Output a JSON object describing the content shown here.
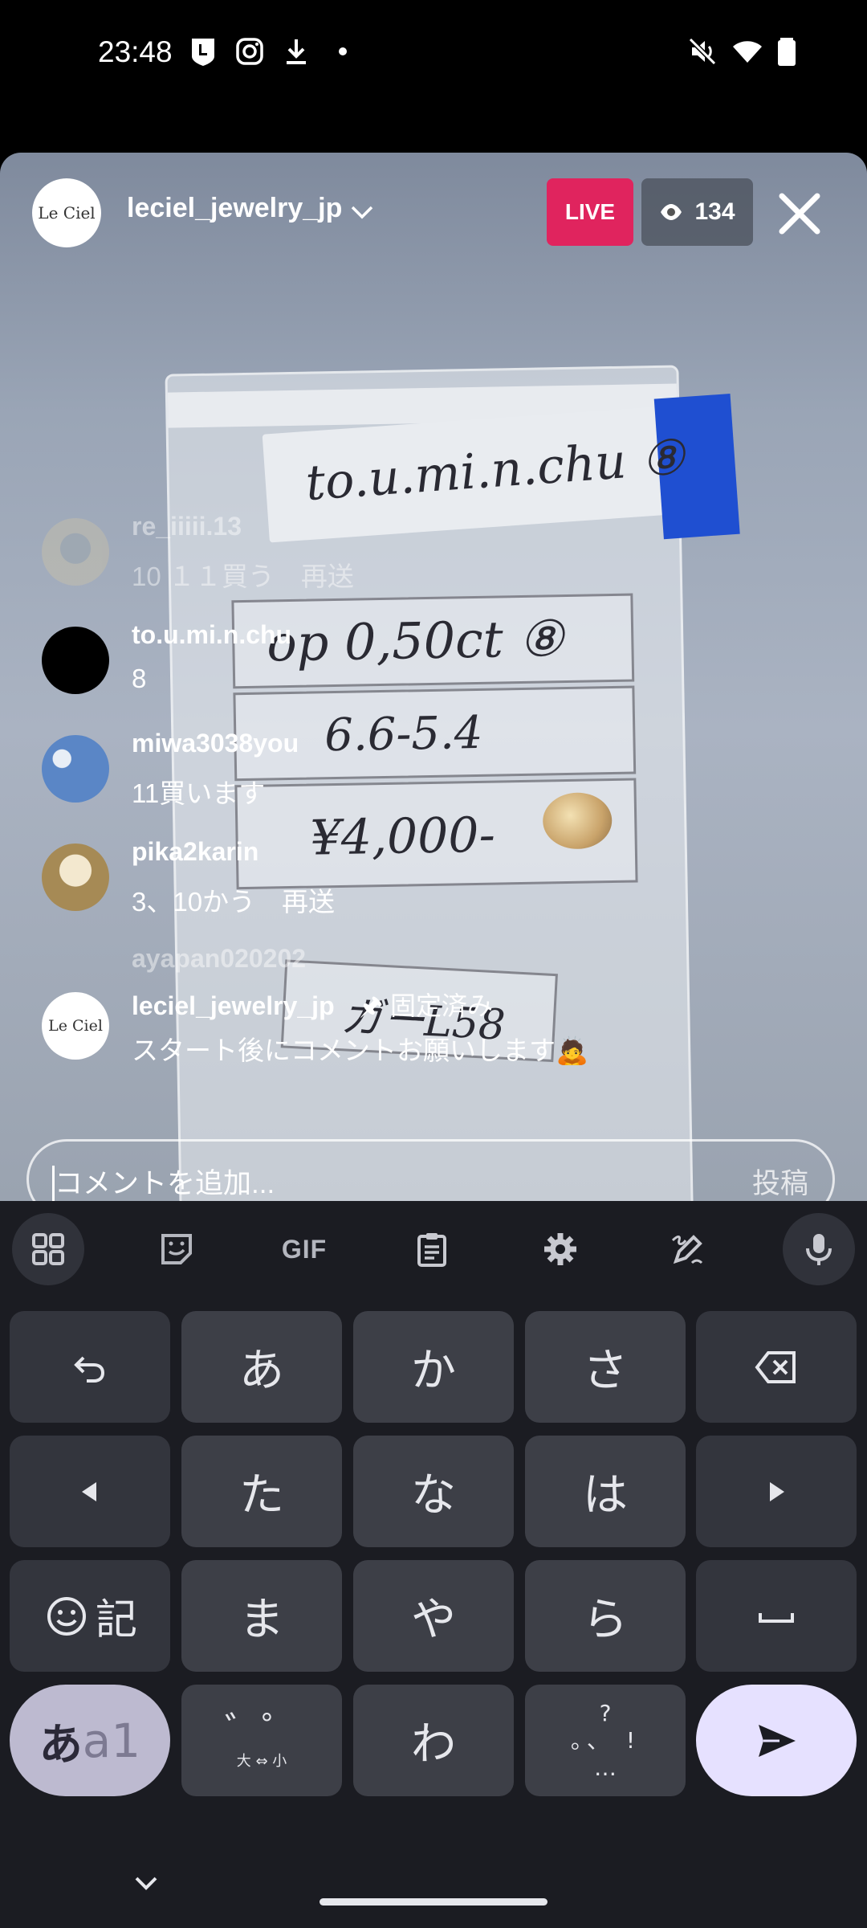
{
  "status_bar": {
    "time": "23:48",
    "left_icons": [
      "line-icon",
      "instagram-icon",
      "download-icon",
      "dot-icon"
    ],
    "right_icons": [
      "mute-icon",
      "wifi-icon",
      "battery-icon"
    ]
  },
  "live": {
    "host_name": "leciel_jewelry_jp",
    "host_avatar_text": "Le Ciel",
    "live_badge": "LIVE",
    "viewer_count": "134",
    "background_handwriting": {
      "card_line": "to.u.mi.n.chu ⑧",
      "line1": "op 0,50ct ⑧",
      "line2": "6.6-5.4",
      "line3": "¥4,000-",
      "line4": "ガーL58"
    },
    "comments": [
      {
        "user": "re_iiiii.13",
        "text": "10 １１買う　再送",
        "faded": true
      },
      {
        "user": "to.u.mi.n.chu",
        "text": "8",
        "faded": false
      },
      {
        "user": "miwa3038you",
        "text": "11買います",
        "faded": false
      },
      {
        "user": "pika2karin",
        "text": "3、10かう　再送",
        "faded": false
      },
      {
        "user": "ayapan020202",
        "text": "",
        "faded": true
      }
    ],
    "pinned": {
      "user": "leciel_jewelry_jp",
      "pin_label": "固定済み",
      "text": "スタート後にコメントお願いします🙇"
    },
    "comment_input": {
      "placeholder": "コメントを追加...",
      "post_label": "投稿"
    }
  },
  "keyboard": {
    "toolbar": [
      "apps-icon",
      "sticker-icon",
      "GIF",
      "clipboard-icon",
      "settings-icon",
      "handwriting-icon",
      "mic-icon"
    ],
    "rows": [
      [
        "undo",
        "あ",
        "か",
        "さ",
        "backspace"
      ],
      [
        "left",
        "た",
        "な",
        "は",
        "right"
      ],
      [
        "emoji記",
        "ま",
        "や",
        "ら",
        "space"
      ],
      [
        "あa1",
        "゛゜大⇔小",
        "わ",
        "。、?!…",
        "send"
      ]
    ],
    "keys": {
      "a": "あ",
      "ka": "か",
      "sa": "さ",
      "ta": "た",
      "na": "な",
      "ha": "は",
      "ma": "ま",
      "ya": "や",
      "ra": "ら",
      "wa": "わ",
      "emoji_kanji": "記",
      "mode_a": "あ",
      "mode_a1": "a1",
      "dakuten": "゛゜",
      "size_switch": "大 ⇔ 小",
      "punct_q": "?",
      "punct_marks": "。、 !",
      "punct_ellipsis": "…"
    },
    "colors": {
      "key": "#3d3f47",
      "background": "#1b1c22",
      "mode_key": "#bdbad0",
      "enter_key": "#e6e1ff"
    }
  }
}
